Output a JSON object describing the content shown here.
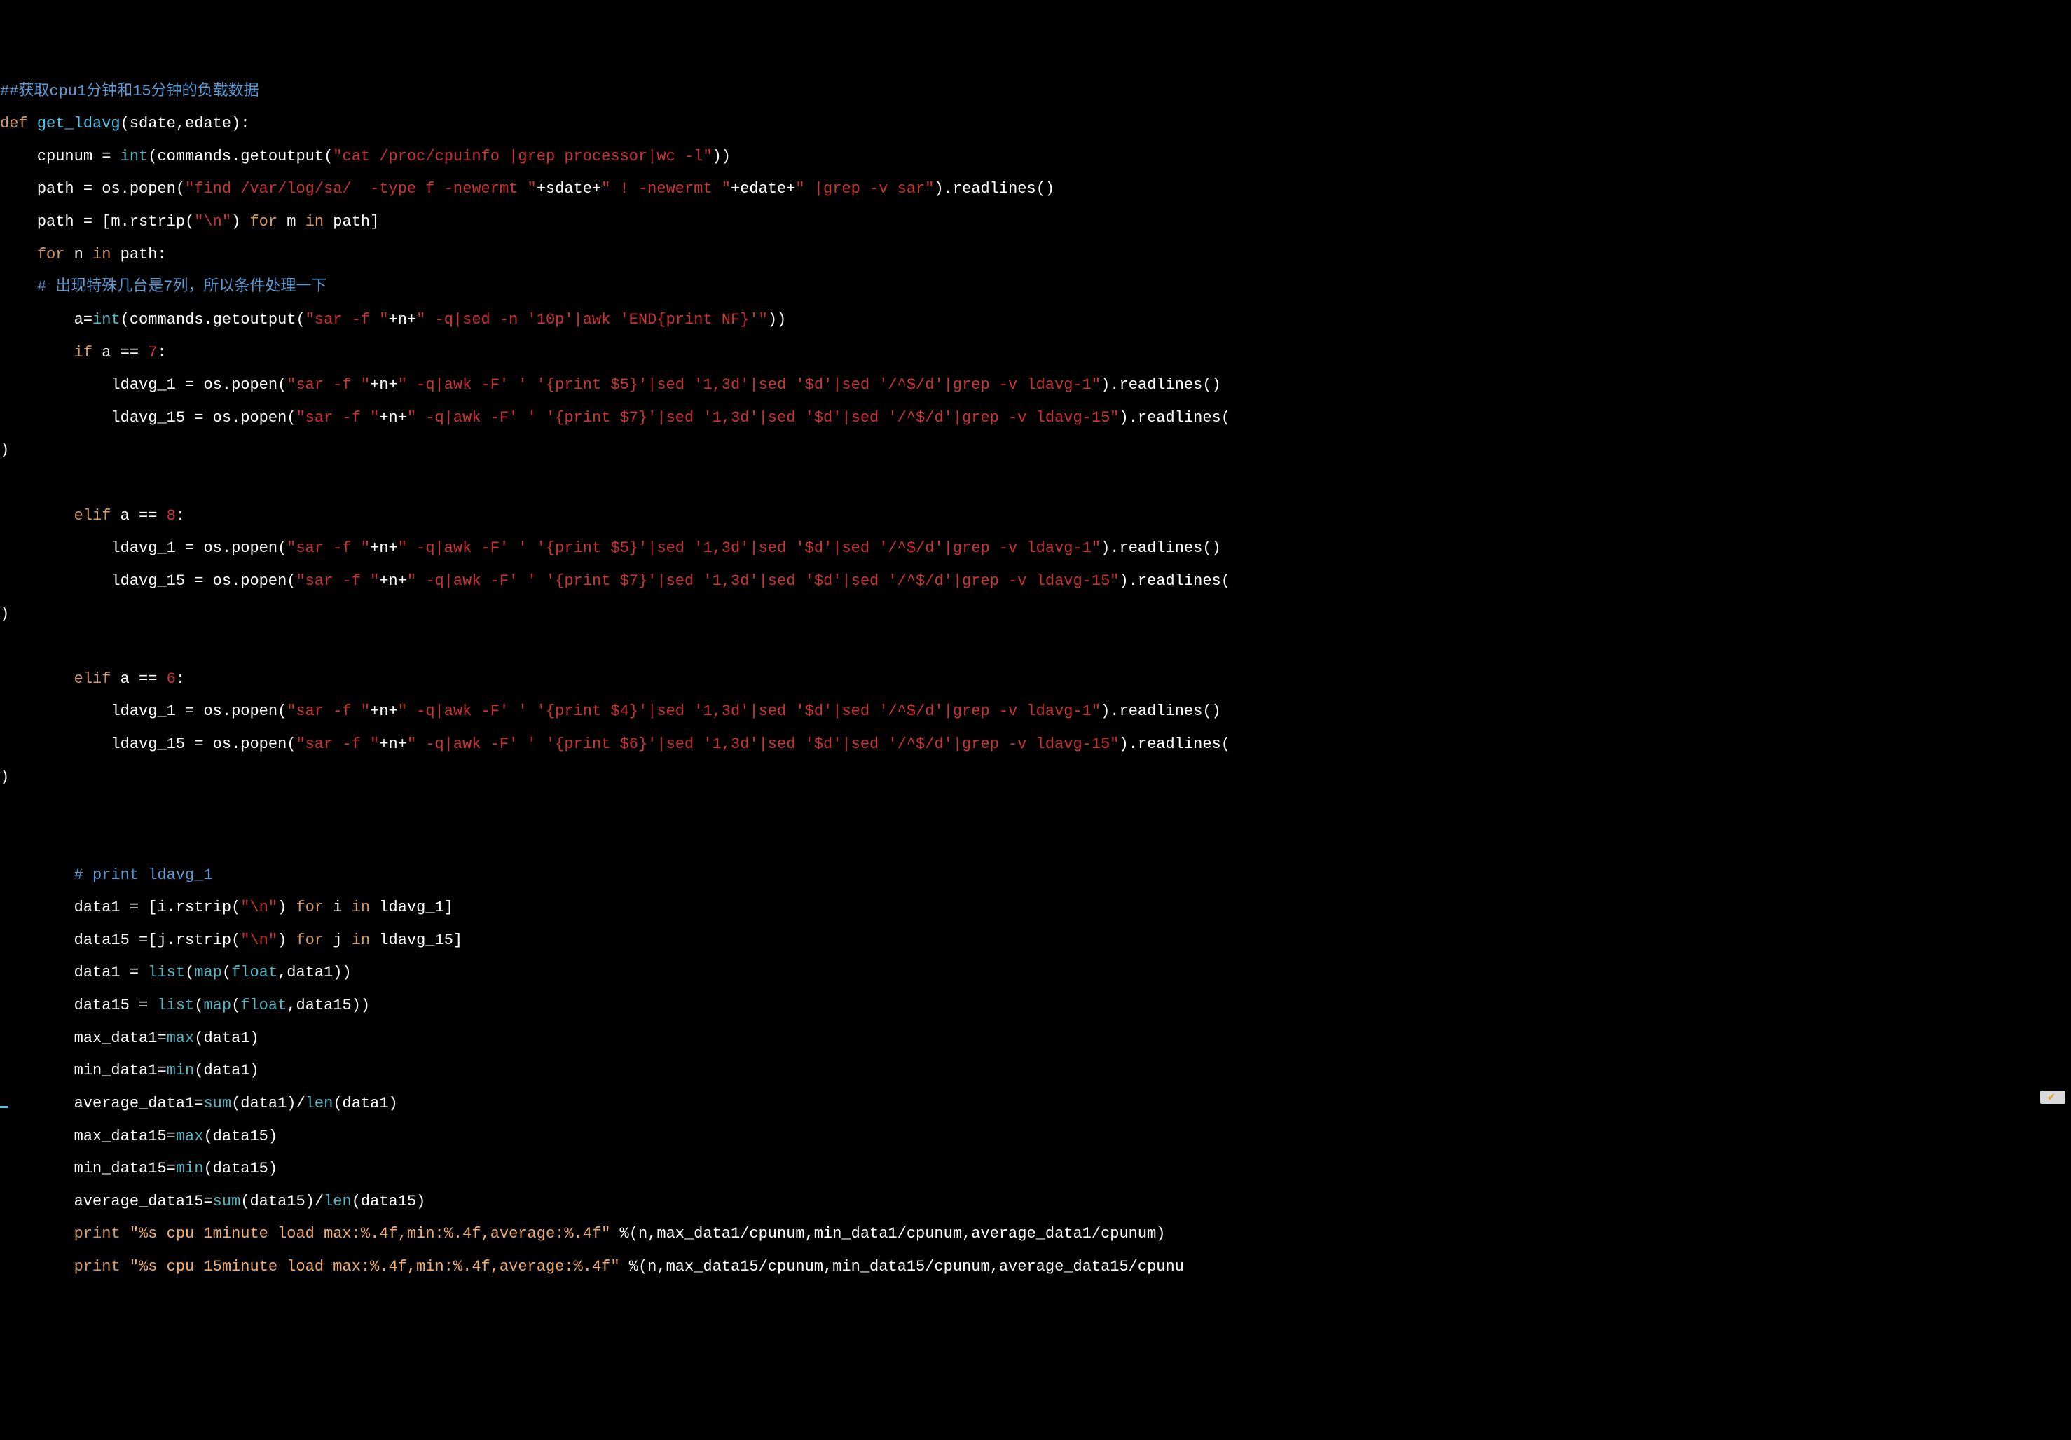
{
  "code": {
    "l1": {
      "comment": "##获取cpu1分钟和15分钟的负载数据"
    },
    "l2": {
      "def": "def",
      "name": "get_ldavg",
      "params": "(sdate,edate):"
    },
    "l3": {
      "indent": "    ",
      "var": "cpunum = ",
      "func": "int",
      "call1": "(commands.getoutput(",
      "str": "\"cat /proc/cpuinfo |grep processor|wc -l\"",
      "end": "))"
    },
    "l4": {
      "indent": "    ",
      "var": "path = os.popen(",
      "str1": "\"find /var/log/sa/  -type f -newermt \"",
      "plus1": "+sdate+",
      "str2": "\" ! -newermt \"",
      "plus2": "+edate+",
      "str3": "\" |grep -v sar\"",
      "end": ").readlines()"
    },
    "l5": {
      "indent": "    ",
      "var": "path = [m.rstrip(",
      "str": "\"\\n\"",
      "mid": ") ",
      "for": "for",
      "m": " m ",
      "in": "in",
      "end": " path]"
    },
    "l6": {
      "indent": "    ",
      "for": "for",
      "n": " n ",
      "in": "in",
      "end": " path:"
    },
    "l7": {
      "indent": "    ",
      "comment": "# 出现特殊几台是7列，所以条件处理一下"
    },
    "l8": {
      "indent": "        ",
      "var": "a=",
      "func": "int",
      "call": "(commands.getoutput(",
      "str1": "\"sar -f \"",
      "plus": "+n+",
      "str2": "\" -q|sed -n '10p'|awk 'END{print NF}'\"",
      "end": "))"
    },
    "l9": {
      "indent": "        ",
      "if": "if",
      "cond": " a == ",
      "num": "7",
      "colon": ":"
    },
    "l10": {
      "indent": "            ",
      "var": "ldavg_1 = os.popen(",
      "str1": "\"sar -f \"",
      "plus": "+n+",
      "str2": "\" -q|awk -F' ' '{print $5}'|sed '1,3d'|sed '$d'|sed '/^$/d'|grep -v ldavg-1\"",
      "end": ").readlines()"
    },
    "l11": {
      "indent": "            ",
      "var": "ldavg_15 = os.popen(",
      "str1": "\"sar -f \"",
      "plus": "+n+",
      "str2": "\" -q|awk -F' ' '{print $7}'|sed '1,3d'|sed '$d'|sed '/^$/d'|grep -v ldavg-15\"",
      "end": ").readlines("
    },
    "l11b": ")",
    "l12": {
      "indent": "        ",
      "elif": "elif",
      "cond": " a == ",
      "num": "8",
      "colon": ":"
    },
    "l13": {
      "indent": "            ",
      "var": "ldavg_1 = os.popen(",
      "str1": "\"sar -f \"",
      "plus": "+n+",
      "str2": "\" -q|awk -F' ' '{print $5}'|sed '1,3d'|sed '$d'|sed '/^$/d'|grep -v ldavg-1\"",
      "end": ").readlines()"
    },
    "l14": {
      "indent": "            ",
      "var": "ldavg_15 = os.popen(",
      "str1": "\"sar -f \"",
      "plus": "+n+",
      "str2": "\" -q|awk -F' ' '{print $7}'|sed '1,3d'|sed '$d'|sed '/^$/d'|grep -v ldavg-15\"",
      "end": ").readlines("
    },
    "l14b": ")",
    "l15": {
      "indent": "        ",
      "elif": "elif",
      "cond": " a == ",
      "num": "6",
      "colon": ":"
    },
    "l16": {
      "indent": "            ",
      "var": "ldavg_1 = os.popen(",
      "str1": "\"sar -f \"",
      "plus": "+n+",
      "str2": "\" -q|awk -F' ' '{print $4}'|sed '1,3d'|sed '$d'|sed '/^$/d'|grep -v ldavg-1\"",
      "end": ").readlines()"
    },
    "l17": {
      "indent": "            ",
      "var": "ldavg_15 = os.popen(",
      "str1": "\"sar -f \"",
      "plus": "+n+",
      "str2": "\" -q|awk -F' ' '{print $6}'|sed '1,3d'|sed '$d'|sed '/^$/d'|grep -v ldavg-15\"",
      "end": ").readlines("
    },
    "l17b": ")",
    "l18": {
      "indent": "        ",
      "comment": "# print ldavg_1"
    },
    "l19": {
      "indent": "        ",
      "var": "data1 = [i.rstrip(",
      "str": "\"\\n\"",
      "mid": ") ",
      "for": "for",
      "i": " i ",
      "in": "in",
      "end": " ldavg_1]"
    },
    "l20": {
      "indent": "        ",
      "var": "data15 =[j.rstrip(",
      "str": "\"\\n\"",
      "mid": ") ",
      "for": "for",
      "j": " j ",
      "in": "in",
      "end": " ldavg_15]"
    },
    "l21": {
      "indent": "        ",
      "var": "data1 = ",
      "func": "list",
      "call": "(",
      "func2": "map",
      "call2": "(",
      "func3": "float",
      "end": ",data1))"
    },
    "l22": {
      "indent": "        ",
      "var": "data15 = ",
      "func": "list",
      "call": "(",
      "func2": "map",
      "call2": "(",
      "func3": "float",
      "end": ",data15))"
    },
    "l23": {
      "indent": "        ",
      "var": "max_data1=",
      "func": "max",
      "end": "(data1)"
    },
    "l24": {
      "indent": "        ",
      "var": "min_data1=",
      "func": "min",
      "end": "(data1)"
    },
    "l25": {
      "indent": "        ",
      "var": "average_data1=",
      "func": "sum",
      "mid": "(data1)/",
      "func2": "len",
      "end": "(data1)"
    },
    "l26": {
      "indent": "        ",
      "var": "max_data15=",
      "func": "max",
      "end": "(data15)"
    },
    "l27": {
      "indent": "        ",
      "var": "min_data15=",
      "func": "min",
      "end": "(data15)"
    },
    "l28": {
      "indent": "        ",
      "var": "average_data15=",
      "func": "sum",
      "mid": "(data15)/",
      "func2": "len",
      "end": "(data15)"
    },
    "l29": {
      "indent": "        ",
      "print": "print",
      "sp": " ",
      "str": "\"%s cpu 1minute load max:%.4f,min:%.4f,average:%.4f\"",
      "end": " %(n,max_data1/cpunum,min_data1/cpunum,average_data1/cpunum)"
    },
    "l30": {
      "indent": "        ",
      "print": "print",
      "sp": " ",
      "str": "\"%s cpu 15minute load max:%.4f,min:%.4f,average:%.4f\"",
      "end": " %(n,max_data15/cpunum,min_data15/cpunum,average_data15/cpunu"
    }
  },
  "watermark": {
    "text": ""
  }
}
